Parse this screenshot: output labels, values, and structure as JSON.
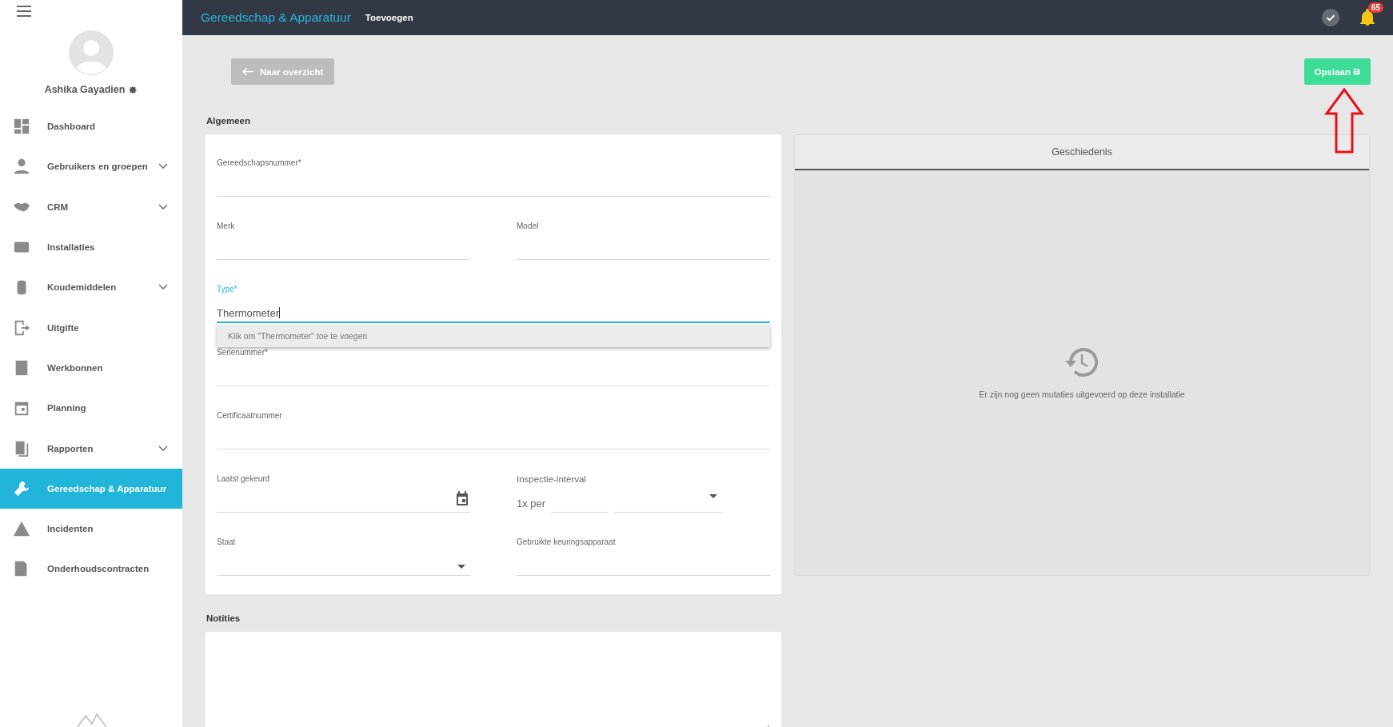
{
  "sidebar": {
    "user": {
      "name": "Ashika Gayadien"
    },
    "items": [
      {
        "label": "Dashboard",
        "expandable": false,
        "selected": false
      },
      {
        "label": "Gebruikers en groepen",
        "expandable": true,
        "selected": false
      },
      {
        "label": "CRM",
        "expandable": true,
        "selected": false
      },
      {
        "label": "Installaties",
        "expandable": false,
        "selected": false
      },
      {
        "label": "Koudemiddelen",
        "expandable": true,
        "selected": false
      },
      {
        "label": "Uitgifte",
        "expandable": false,
        "selected": false
      },
      {
        "label": "Werkbonnen",
        "expandable": false,
        "selected": false
      },
      {
        "label": "Planning",
        "expandable": false,
        "selected": false
      },
      {
        "label": "Rapporten",
        "expandable": true,
        "selected": false
      },
      {
        "label": "Gereedschap & Apparatuur",
        "expandable": false,
        "selected": true
      },
      {
        "label": "Incidenten",
        "expandable": false,
        "selected": false
      },
      {
        "label": "Onderhoudscontracten",
        "expandable": false,
        "selected": false
      }
    ]
  },
  "header": {
    "title": "Gereedschap & Apparatuur",
    "subtitle": "Toevoegen",
    "notifications": "65"
  },
  "toolbar": {
    "back": "Naar overzicht",
    "save": "Opslaan"
  },
  "general": {
    "title": "Algemeen",
    "rows": [
      [
        {
          "kind": "text",
          "label": "Gereedschapsnummer*",
          "focused": false
        }
      ],
      [
        {
          "kind": "text",
          "label": "Merk",
          "focused": false
        },
        {
          "kind": "text",
          "label": "Model",
          "focused": false
        }
      ],
      [
        {
          "kind": "typeahead",
          "label": "Type*",
          "value": "Thermometer",
          "focused": true,
          "suggestion": "Klik om \"Thermometer\" toe te voegen"
        }
      ],
      [
        {
          "kind": "text",
          "label": "Serienummer*",
          "focused": false
        }
      ],
      [
        {
          "kind": "text",
          "label": "Certificaatnummer",
          "focused": false
        }
      ],
      [
        {
          "kind": "date",
          "label": "Laatst gekeurd",
          "focused": false
        },
        {
          "kind": "interval",
          "label": "Inspectie-interval",
          "prefix": "1x per",
          "focused": false
        }
      ],
      [
        {
          "kind": "select",
          "label": "Staat",
          "focused": false
        },
        {
          "kind": "text",
          "label": "Gebruikte keuringsapparaat",
          "focused": false
        }
      ]
    ]
  },
  "history": {
    "title": "Geschiedenis",
    "empty": "Er zijn nog geen mutaties uitgevoerd op deze installatie"
  },
  "notes": {
    "title": "Notities"
  }
}
